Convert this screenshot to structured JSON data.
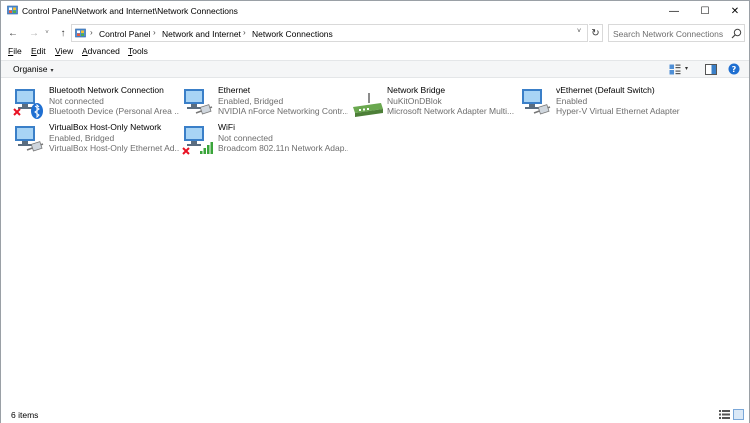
{
  "window": {
    "title": "Control Panel\\Network and Internet\\Network Connections",
    "minimize_glyph": "—",
    "maximize_glyph": "☐",
    "close_glyph": "✕"
  },
  "nav": {
    "back_glyph": "←",
    "forward_glyph": "→",
    "recent_glyph": "˅",
    "up_glyph": "↑",
    "refresh_glyph": "↻"
  },
  "address": {
    "separator": "›",
    "crumbs": [
      "Control Panel",
      "Network and Internet",
      "Network Connections"
    ],
    "dropdown_glyph": "˅"
  },
  "search": {
    "placeholder": "Search Network Connections"
  },
  "menu": {
    "items": [
      {
        "ul": "F",
        "rest": "ile"
      },
      {
        "ul": "E",
        "rest": "dit"
      },
      {
        "ul": "V",
        "rest": "iew"
      },
      {
        "ul": "A",
        "rest": "dvanced"
      },
      {
        "ul": "T",
        "rest": "ools"
      }
    ]
  },
  "commandbar": {
    "organise_label": "Organise",
    "caret_glyph": "▾"
  },
  "connections": [
    {
      "name": "Bluetooth Network Connection",
      "status": "Not connected",
      "device": "Bluetooth Device (Personal Area ...",
      "icon": "bluetooth-network-icon",
      "disconnected": true,
      "badge": "bluetooth"
    },
    {
      "name": "Ethernet",
      "status": "Enabled, Bridged",
      "device": "NVIDIA nForce Networking Contr...",
      "icon": "ethernet-network-icon",
      "disconnected": false,
      "badge": "cable"
    },
    {
      "name": "Network Bridge",
      "status": "NuKitOnDBlok",
      "device": "Microsoft Network Adapter Multi...",
      "icon": "network-bridge-icon",
      "disconnected": false,
      "badge": "bridge"
    },
    {
      "name": "vEthernet (Default Switch)",
      "status": "Enabled",
      "device": "Hyper-V Virtual Ethernet Adapter",
      "icon": "vethernet-network-icon",
      "disconnected": false,
      "badge": "cable"
    },
    {
      "name": "VirtualBox Host-Only Network",
      "status": "Enabled, Bridged",
      "device": "VirtualBox Host-Only Ethernet Ad...",
      "icon": "virtualbox-network-icon",
      "disconnected": false,
      "badge": "cable"
    },
    {
      "name": "WiFi",
      "status": "Not connected",
      "device": "Broadcom 802.11n Network Adap...",
      "icon": "wifi-network-icon",
      "disconnected": true,
      "badge": "wifi"
    }
  ],
  "status": {
    "count": "6 items"
  },
  "colors": {
    "monitor_frame": "#3a7fc8",
    "monitor_screen": "#a8d4f5",
    "error_red": "#e81123",
    "bluetooth_blue": "#1f6fd1",
    "wifi_green": "#3aa53a"
  }
}
